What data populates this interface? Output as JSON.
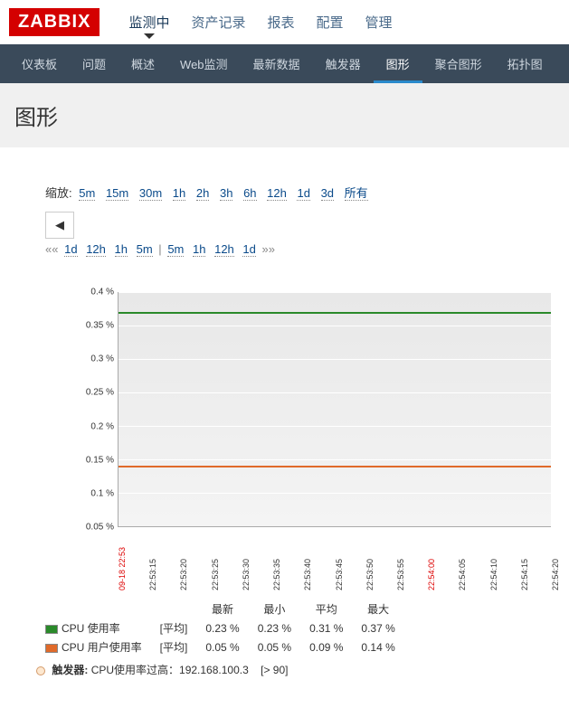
{
  "logo": "ZABBIX",
  "topnav": [
    "监测中",
    "资产记录",
    "报表",
    "配置",
    "管理"
  ],
  "topnav_active": 0,
  "subnav": [
    "仪表板",
    "问题",
    "概述",
    "Web监测",
    "最新数据",
    "触发器",
    "图形",
    "聚合图形",
    "拓扑图"
  ],
  "subnav_active": 6,
  "page_title": "图形",
  "controls": {
    "zoom_label": "缩放:",
    "zoom_opts": [
      "5m",
      "15m",
      "30m",
      "1h",
      "2h",
      "3h",
      "6h",
      "12h",
      "1d",
      "3d",
      "所有"
    ],
    "prev_icon": "◀",
    "shift_left_dbl": "««",
    "shift_left": [
      "1d",
      "12h",
      "1h",
      "5m"
    ],
    "shift_sep": "|",
    "shift_right": [
      "5m",
      "1h",
      "12h",
      "1d"
    ],
    "shift_right_dbl": "»»"
  },
  "chart_data": {
    "type": "line",
    "ylim": [
      0.05,
      0.4
    ],
    "yticks": [
      "0.4 %",
      "0.35 %",
      "0.3 %",
      "0.25 %",
      "0.2 %",
      "0.15 %",
      "0.1 %",
      "0.05 %"
    ],
    "xticks": [
      {
        "label": "09-18 22:53",
        "red": true
      },
      {
        "label": "22:53:15"
      },
      {
        "label": "22:53:20"
      },
      {
        "label": "22:53:25"
      },
      {
        "label": "22:53:30"
      },
      {
        "label": "22:53:35"
      },
      {
        "label": "22:53:40"
      },
      {
        "label": "22:53:45"
      },
      {
        "label": "22:53:50"
      },
      {
        "label": "22:53:55"
      },
      {
        "label": "22:54:00",
        "red": true
      },
      {
        "label": "22:54:05"
      },
      {
        "label": "22:54:10"
      },
      {
        "label": "22:54:15"
      },
      {
        "label": "22:54:20"
      }
    ],
    "series": [
      {
        "name": "CPU 使用率",
        "color": "#2a8a2a",
        "approx_value": 0.37
      },
      {
        "name": "CPU 用户使用率",
        "color": "#e06a2a",
        "approx_value": 0.14
      }
    ]
  },
  "legend": {
    "headers": [
      "最新",
      "最小",
      "平均",
      "最大"
    ],
    "agg_label": "[平均]",
    "rows": [
      {
        "name": "CPU 使用率",
        "color": "#2a8a2a",
        "values": [
          "0.23 %",
          "0.23 %",
          "0.31 %",
          "0.37 %"
        ]
      },
      {
        "name": "CPU 用户使用率",
        "color": "#e06a2a",
        "values": [
          "0.05 %",
          "0.05 %",
          "0.09 %",
          "0.14 %"
        ]
      }
    ],
    "trigger_label": "触发器:",
    "trigger_text": "CPU使用率过高：192.168.100.3",
    "trigger_cond": "[> 90]"
  }
}
